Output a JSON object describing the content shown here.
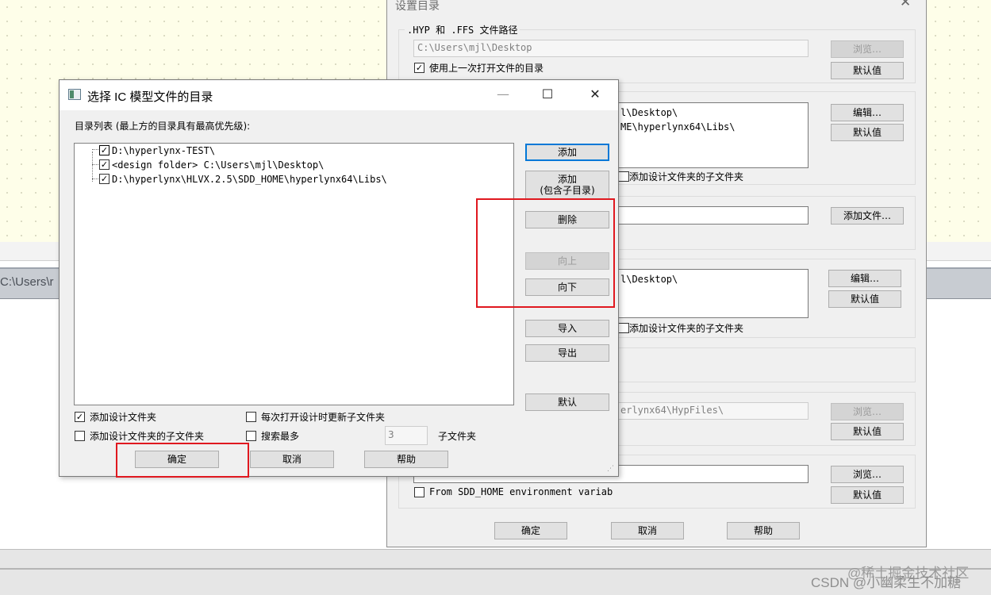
{
  "background": {
    "path_text": "C:\\Users\\r",
    "watermark_line1": "@稀土掘金技术社区",
    "watermark_line2": "CSDN @小幽柔生不加糖"
  },
  "back_dialog": {
    "title": "设置目录",
    "close_glyph": "✕",
    "section_hyp_label": ".HYP 和 .FFS 文件路径",
    "hyp_path": "C:\\Users\\mjl\\Desktop",
    "use_last_checkbox_label": "使用上一次打开文件的目录",
    "browse_label": "浏览…",
    "default_label": "默认值",
    "edit_label": "编辑…",
    "list1_lines": [
      "l\\Desktop\\",
      "ME\\hyperlynx64\\Libs\\"
    ],
    "add_sub_checkbox_label": "添加设计文件夹的子文件夹",
    "add_file_label": "添加文件…",
    "list2_lines": [
      "l\\Desktop\\"
    ],
    "hypfiles_path": "erlynx64\\HypFiles\\",
    "sdd_checkbox_label": "From SDD_HOME environment variab",
    "ok_label": "确定",
    "cancel_label": "取消",
    "help_label": "帮助"
  },
  "front_dialog": {
    "title": "选择 IC 模型文件的目录",
    "minimize_glyph": "—",
    "maximize_glyph": "☐",
    "close_glyph": "✕",
    "list_caption": "目录列表 (最上方的目录具有最高优先级):",
    "entries": [
      {
        "text": "D:\\hyperlynx-TEST\\",
        "checked": true
      },
      {
        "text": "<design folder>  C:\\Users\\mjl\\Desktop\\",
        "checked": true
      },
      {
        "text": "D:\\hyperlynx\\HLVX.2.5\\SDD_HOME\\hyperlynx64\\Libs\\",
        "checked": true
      }
    ],
    "buttons": {
      "add": "添加",
      "add_with_sub_line1": "添加",
      "add_with_sub_line2": "(包含子目录)",
      "delete": "删除",
      "move_up": "向上",
      "move_down": "向下",
      "import": "导入",
      "export": "导出",
      "default": "默认",
      "ok": "确定",
      "cancel": "取消",
      "help": "帮助"
    },
    "checkboxes": {
      "add_design_folder": {
        "label": "添加设计文件夹",
        "checked": true
      },
      "add_design_subfolders": {
        "label": "添加设计文件夹的子文件夹",
        "checked": false
      },
      "refresh_subfolders": {
        "label": "每次打开设计时更新子文件夹",
        "checked": false
      },
      "search_most": {
        "label": "搜索最多",
        "checked": false
      }
    },
    "search_depth_value": "3",
    "subfolder_label": "子文件夹",
    "check_glyph": "✓"
  },
  "colors": {
    "highlight_red": "#e0181f"
  }
}
